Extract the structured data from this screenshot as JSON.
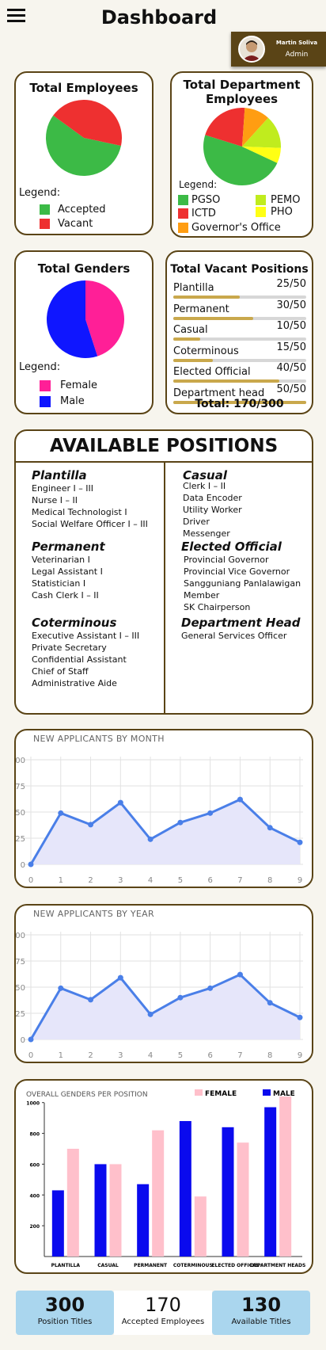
{
  "header": {
    "title": "Dashboard"
  },
  "user": {
    "name": "Martin Soliva",
    "role": "Admin"
  },
  "total_employees": {
    "title": "Total Employees",
    "legend_label": "Legend:",
    "slices": [
      {
        "name": "Accepted",
        "value": 170,
        "color": "#3cba46"
      },
      {
        "name": "Vacant",
        "value": 130,
        "color": "#ee3030"
      }
    ]
  },
  "department": {
    "title_line1": "Total Department",
    "title_line2": "Employees",
    "legend_label": "Legend:",
    "slices": [
      {
        "name": "PGSO",
        "value": 45,
        "color": "#3cba46"
      },
      {
        "name": "ICTD",
        "value": 20,
        "color": "#ee3030"
      },
      {
        "name": "Governor's Office",
        "value": 10,
        "color": "#ff9d12"
      },
      {
        "name": "PEMO",
        "value": 13,
        "color": "#c0ec1e"
      },
      {
        "name": "PHO",
        "value": 6,
        "color": "#ffff14"
      }
    ]
  },
  "genders": {
    "title": "Total Genders",
    "legend_label": "Legend:",
    "slices": [
      {
        "name": "Female",
        "value": 45,
        "color": "#ff1f97"
      },
      {
        "name": "Male",
        "value": 55,
        "color": "#0f16ff"
      }
    ]
  },
  "vacant": {
    "title": "Total Vacant Positions",
    "rows": [
      {
        "label": "Plantilla",
        "text": "25/50",
        "fraction": 0.5
      },
      {
        "label": "Permanent",
        "text": "30/50",
        "fraction": 0.6
      },
      {
        "label": "Casual",
        "text": "10/50",
        "fraction": 0.2
      },
      {
        "label": "Coterminous",
        "text": "15/50",
        "fraction": 0.3
      },
      {
        "label": "Elected Official",
        "text": "40/50",
        "fraction": 0.8
      },
      {
        "label": "Department head",
        "text": "50/50",
        "fraction": 1.0
      }
    ],
    "total": "Total: 170/300"
  },
  "positions": {
    "title": "AVAILABLE POSITIONS",
    "plantilla": {
      "head": "Plantilla",
      "items": [
        "Engineer I – III",
        "Nurse I – II",
        "Medical Technologist I",
        "Social Welfare Officer I – III"
      ]
    },
    "permanent": {
      "head": "Permanent",
      "items": [
        "Veterinarian I",
        "Legal Assistant I",
        "Statistician I",
        "Cash Clerk I – II"
      ]
    },
    "coterminous": {
      "head": "Coterminous",
      "items": [
        "Executive Assistant I – III",
        "Private Secretary",
        "Confidential Assistant",
        "Chief of Staff",
        "Administrative Aide"
      ]
    },
    "casual": {
      "head": "Casual",
      "items": [
        "Clerk I – II",
        "Data Encoder",
        "Utility Worker",
        "Driver",
        "Messenger"
      ]
    },
    "elected": {
      "head": "Elected Official",
      "items": [
        "Provincial Governor",
        "Provincial Vice Governor",
        "Sangguniang Panlalawigan",
        "Member",
        "SK Chairperson"
      ]
    },
    "dept": {
      "head": "Department  Head",
      "items": [
        "General Services Officer"
      ]
    }
  },
  "applicants_month": {
    "title": "NEW APPLICANTS BY MONTH",
    "chart_data": {
      "type": "area",
      "x": [
        0,
        1,
        2,
        3,
        4,
        5,
        6,
        7,
        8,
        9
      ],
      "y": [
        0,
        49,
        38,
        59,
        24,
        40,
        49,
        62,
        35,
        21
      ],
      "ylim": [
        0,
        100
      ],
      "yticks": [
        "0",
        "25",
        "50",
        "75",
        "00"
      ],
      "line_color": "#4a7fe8",
      "fill_color": "#e6e6fa"
    }
  },
  "applicants_year": {
    "title": "NEW APPLICANTS BY YEAR",
    "chart_data": {
      "type": "area",
      "x": [
        0,
        1,
        2,
        3,
        4,
        5,
        6,
        7,
        8,
        9
      ],
      "y": [
        0,
        49,
        38,
        59,
        24,
        40,
        49,
        62,
        35,
        21
      ],
      "ylim": [
        0,
        100
      ],
      "yticks": [
        "0",
        "25",
        "50",
        "75",
        "00"
      ],
      "line_color": "#4a7fe8",
      "fill_color": "#e6e6fa"
    }
  },
  "gender_positions": {
    "title": "OVERALL GENDERS PER POSITION",
    "chart_data": {
      "type": "bar",
      "categories": [
        "PLANTILLA",
        "CASUAL",
        "PERMANENT",
        "COTERMINOUS",
        "ELECTED OFFICAL",
        "DEPARTMENT HEADS"
      ],
      "series": [
        {
          "name": "MALE",
          "color": "#0a0aee",
          "values": [
            430,
            600,
            470,
            880,
            840,
            970
          ]
        },
        {
          "name": "FEMALE",
          "color": "#ffc0cb",
          "values": [
            700,
            600,
            820,
            390,
            740,
            1040
          ]
        }
      ],
      "ylim": [
        0,
        1050
      ],
      "yticks": [
        200,
        400,
        600,
        800,
        1000
      ]
    }
  },
  "stats": [
    {
      "num": "300",
      "label": "Position Titles"
    },
    {
      "num": "170",
      "label": "Accepted Employees"
    },
    {
      "num": "130",
      "label": "Available Titles"
    }
  ]
}
